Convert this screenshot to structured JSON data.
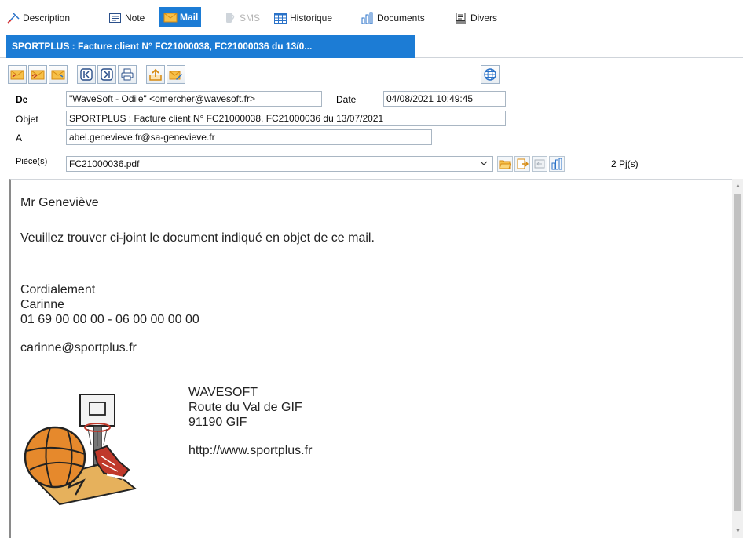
{
  "tabs": [
    {
      "label": "Description",
      "icon": "pin-icon",
      "state": "normal"
    },
    {
      "label": "Note",
      "icon": "note-icon",
      "state": "normal"
    },
    {
      "label": "Mail",
      "icon": "envelope-icon",
      "state": "active"
    },
    {
      "label": "SMS",
      "icon": "phone-icon",
      "state": "disabled"
    },
    {
      "label": "Historique",
      "icon": "calendar-icon",
      "state": "normal"
    },
    {
      "label": "Documents",
      "icon": "documents-icon",
      "state": "normal"
    },
    {
      "label": "Divers",
      "icon": "misc-icon",
      "state": "normal"
    }
  ],
  "subject_tab": "SPORTPLUS : Facture client N° FC21000038, FC21000036 du 13/0...",
  "toolbar": {
    "buttons": [
      "reply-icon",
      "reply-all-icon",
      "forward-icon",
      "previous-icon",
      "next-icon",
      "print-icon",
      "export-icon",
      "edit-icon",
      "web-icon"
    ]
  },
  "header": {
    "from_label": "De",
    "from_value": "\"WaveSoft - Odile\" <omercher@wavesoft.fr>",
    "date_label": "Date",
    "date_value": "04/08/2021 10:49:45",
    "subject_label": "Objet",
    "subject_value": "SPORTPLUS : Facture client N° FC21000038, FC21000036 du 13/07/2021",
    "to_label": "A",
    "to_value": "abel.genevieve.fr@sa-genevieve.fr",
    "attach_label": "Pièce(s)",
    "attach_value": "FC21000036.pdf",
    "attach_count": "2 Pj(s)"
  },
  "message": {
    "greeting": "Mr  Geneviève",
    "line1": "Veuillez trouver ci-joint le document indiqué en objet de ce mail.",
    "closing": "Cordialement",
    "name": "Carinne",
    "phones": "01 69 00 00 00 - 06 00 00 00 00",
    "email": "carinne@sportplus.fr",
    "company": "WAVESOFT",
    "street": "Route du Val de GIF",
    "city": "91190 GIF",
    "website": "http://www.sportplus.fr"
  },
  "colors": {
    "accent": "#1c7cd5",
    "icon_orange": "#f4a422"
  }
}
